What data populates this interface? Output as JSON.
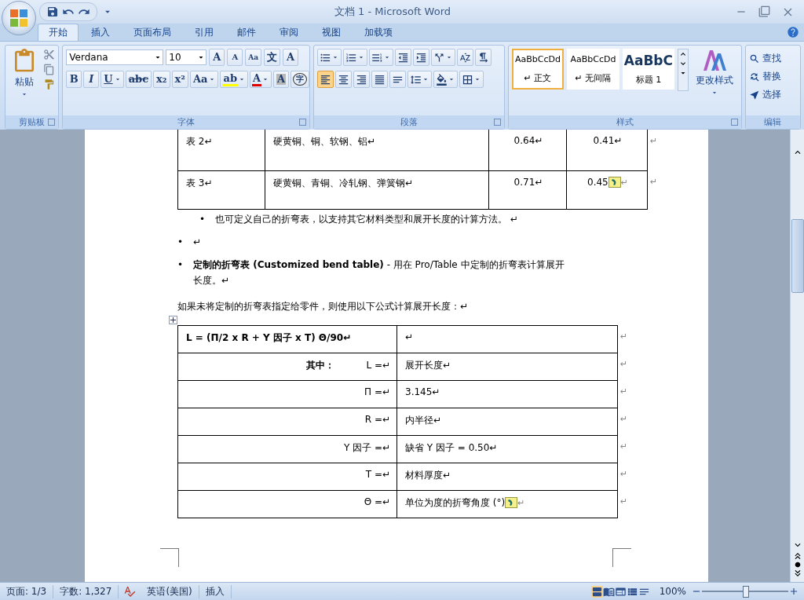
{
  "window": {
    "title": "文档 1 - Microsoft Word"
  },
  "ribbon_tabs": [
    {
      "label": "开始",
      "selected": true
    },
    {
      "label": "插入",
      "selected": false
    },
    {
      "label": "页面布局",
      "selected": false
    },
    {
      "label": "引用",
      "selected": false
    },
    {
      "label": "邮件",
      "selected": false
    },
    {
      "label": "审阅",
      "selected": false
    },
    {
      "label": "视图",
      "selected": false
    },
    {
      "label": "加载项",
      "selected": false
    }
  ],
  "clipboard": {
    "paste_label": "粘贴",
    "group_label": "剪贴板"
  },
  "font": {
    "name": "Verdana",
    "size": "10",
    "group_label": "字体",
    "top_buttons": [
      {
        "glyph": "A",
        "kind": "grow"
      },
      {
        "glyph": "A",
        "kind": "shrink"
      },
      {
        "glyph": "Aa",
        "kind": "clear"
      },
      {
        "glyph": "文",
        "kind": "phonetic"
      },
      {
        "glyph": "A",
        "kind": "border"
      }
    ],
    "bottom_buttons": [
      {
        "glyph": "B",
        "kind": "bold",
        "dropdown": false
      },
      {
        "glyph": "I",
        "kind": "italic",
        "dropdown": false
      },
      {
        "glyph": "U",
        "kind": "underline",
        "dropdown": true
      },
      {
        "glyph": "abc",
        "kind": "strike",
        "dropdown": false
      },
      {
        "glyph": "x₂",
        "kind": "plain",
        "dropdown": false
      },
      {
        "glyph": "x²",
        "kind": "plain",
        "dropdown": false
      },
      {
        "glyph": "Aa",
        "kind": "plain",
        "dropdown": true
      },
      {
        "glyph": "ab",
        "kind": "colorbar",
        "color": "#ffff00",
        "dropdown": true
      },
      {
        "glyph": "A",
        "kind": "colorbar",
        "color": "#e00000",
        "dropdown": true
      },
      {
        "glyph": "A",
        "kind": "shade",
        "dropdown": false
      },
      {
        "glyph": "字",
        "kind": "circle",
        "dropdown": false
      }
    ]
  },
  "paragraph": {
    "group_label": "段落",
    "top_buttons": [
      {
        "kind": "bullets",
        "dropdown": true
      },
      {
        "kind": "numbering",
        "dropdown": true
      },
      {
        "kind": "multilevel",
        "dropdown": true
      },
      {
        "kind": "outdent",
        "dropdown": false
      },
      {
        "kind": "indent",
        "dropdown": false
      },
      {
        "kind": "layout",
        "dropdown": true
      },
      {
        "kind": "sort",
        "dropdown": false
      },
      {
        "kind": "marks",
        "dropdown": false
      }
    ],
    "bottom_buttons": [
      {
        "kind": "left",
        "selected": true,
        "dropdown": false
      },
      {
        "kind": "center",
        "selected": false,
        "dropdown": false
      },
      {
        "kind": "right",
        "selected": false,
        "dropdown": false
      },
      {
        "kind": "justify",
        "selected": false,
        "dropdown": false
      },
      {
        "kind": "distribute",
        "selected": false,
        "dropdown": false
      },
      {
        "kind": "spacing",
        "selected": false,
        "dropdown": true
      },
      {
        "kind": "fill",
        "selected": false,
        "dropdown": true
      },
      {
        "kind": "borders",
        "selected": false,
        "dropdown": true
      }
    ]
  },
  "styles": {
    "group_label": "样式",
    "change_label": "更改样式",
    "items": [
      {
        "preview": "AaBbCcDd",
        "name": "↵ 正文",
        "kind": "normal",
        "selected": true
      },
      {
        "preview": "AaBbCcDd",
        "name": "↵ 无间隔",
        "kind": "normal",
        "selected": false
      },
      {
        "preview": "AaBbC",
        "name": "标题 1",
        "kind": "heading",
        "selected": false
      }
    ]
  },
  "editing": {
    "group_label": "编辑",
    "items": [
      {
        "label": "查找",
        "kind": "find"
      },
      {
        "label": "替换",
        "kind": "replace"
      },
      {
        "label": "选择",
        "kind": "select"
      }
    ]
  },
  "document": {
    "top_table": [
      {
        "cells": [
          "表 2↵",
          "硬黄铜、铜、软钢、铝↵",
          "0.64↵",
          "0.41↵"
        ],
        "smart_tag": false,
        "end_mark": "↵"
      },
      {
        "cells": [
          "表 3↵",
          "硬黄铜、青铜、冷轧钢、弹簧钢↵",
          "0.71↵",
          "0.45"
        ],
        "smart_tag": true,
        "tag_mark": "↵",
        "end_mark": "↵"
      }
    ],
    "paragraphs": [
      {
        "kind": "sub_bullet",
        "bullet": "•",
        "text": "也可定义自己的折弯表，以支持其它材料类型和展开长度的计算方法。 ↵"
      },
      {
        "kind": "bullet",
        "bullet": "•",
        "text": "↵"
      },
      {
        "kind": "bullet",
        "bullet": "•",
        "text": "**定制的折弯表 (Customized bend table)** - 用在 Pro/Table 中定制的折弯表计算展开长度。↵"
      },
      {
        "kind": "plain",
        "text": "如果未将定制的折弯表指定给零件，则使用以下公式计算展开长度：↵"
      }
    ],
    "formula_table": [
      {
        "kind": "formula",
        "left": "L = (Π/2 x R + Y 因子 x T) Θ/90↵",
        "right": "↵",
        "smart_tag": false,
        "end_mark": "↵"
      },
      {
        "kind": "term",
        "label": "其中：",
        "left": "L =↵",
        "right": "展开长度↵",
        "smart_tag": false,
        "end_mark": "↵"
      },
      {
        "kind": "term",
        "left": "Π =↵",
        "right": "3.145↵",
        "smart_tag": false,
        "end_mark": "↵"
      },
      {
        "kind": "term",
        "left": "R =↵",
        "right": "内半径↵",
        "smart_tag": false,
        "end_mark": "↵"
      },
      {
        "kind": "term",
        "left": "Y 因子 =↵",
        "right": "缺省 Y 因子 = 0.50↵",
        "smart_tag": false,
        "end_mark": "↵"
      },
      {
        "kind": "term",
        "left": "T =↵",
        "right": "材料厚度↵",
        "smart_tag": false,
        "end_mark": "↵"
      },
      {
        "kind": "term",
        "left": "Θ =↵",
        "right": "单位为度的折弯角度 (°)",
        "smart_tag": true,
        "tag_mark": "↵",
        "end_mark": "↵"
      }
    ]
  },
  "status_bar": {
    "page": "页面: 1/3",
    "words": "字数: 1,327",
    "language": "英语(美国)",
    "mode": "插入",
    "zoom": "100%",
    "zoom_slider": {
      "level": 0.5
    }
  }
}
